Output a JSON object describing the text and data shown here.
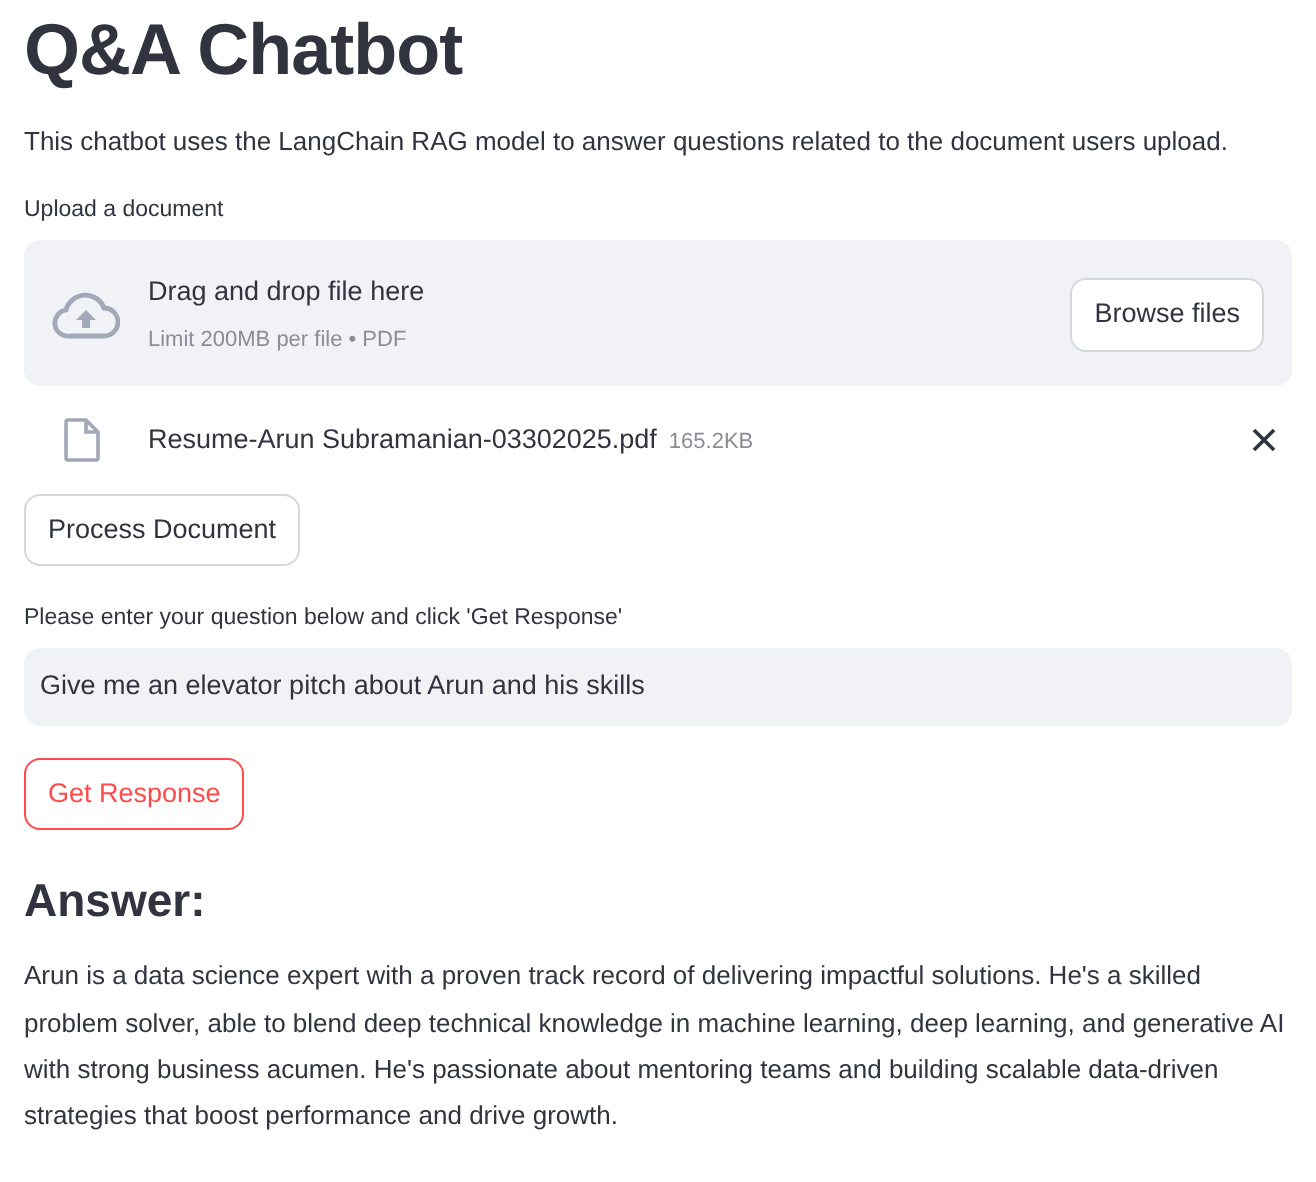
{
  "title": "Q&A Chatbot",
  "intro": "This chatbot uses the LangChain RAG model to answer questions related to the document users upload.",
  "uploader": {
    "label": "Upload a document",
    "drop_text": "Drag and drop file here",
    "limit_text": "Limit 200MB per file • PDF",
    "browse_button": "Browse files",
    "files": [
      {
        "name": "Resume-Arun Subramanian-03302025.pdf",
        "size": "165.2KB"
      }
    ]
  },
  "process_button": "Process Document",
  "question": {
    "label": "Please enter your question below and click 'Get Response'",
    "value": "Give me an elevator pitch about Arun and his skills"
  },
  "response_button": "Get Response",
  "answer": {
    "heading": "Answer:",
    "text": "Arun is a data science expert with a proven track record of delivering impactful solutions. He's a skilled problem solver, able to blend deep technical knowledge in machine learning, deep learning, and generative AI with strong business acumen. He's passionate about mentoring teams and building scalable data-driven strategies that boost performance and drive growth."
  }
}
